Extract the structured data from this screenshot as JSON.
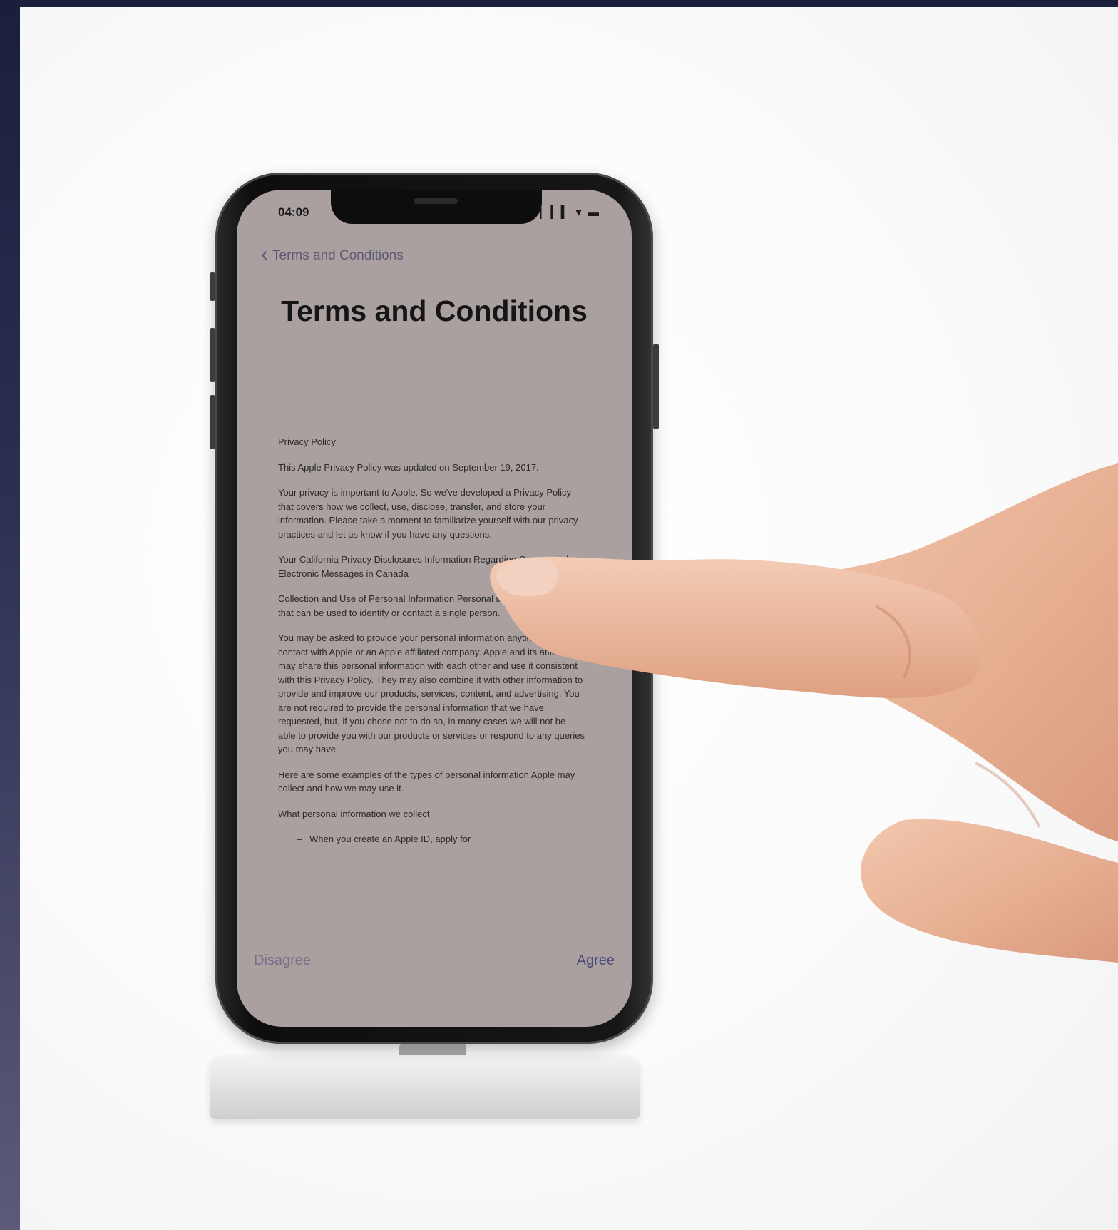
{
  "status_bar": {
    "time": "04:09",
    "icons": "▏▎▍ ▾ ▬"
  },
  "nav": {
    "back_label": "Terms and Conditions"
  },
  "title": "Terms and Conditions",
  "document": {
    "paragraphs": [
      "Privacy Policy",
      "This Apple Privacy Policy was updated on September 19, 2017.",
      "Your privacy is important to Apple. So we've developed a Privacy Policy that covers how we collect, use, disclose, transfer, and store your information. Please take a moment to familiarize yourself with our privacy practices and let us know if you have any questions.",
      "Your California Privacy Disclosures Information Regarding Commercial Electronic Messages in Canada",
      "Collection and Use of Personal Information Personal information is data that can be used to identify or contact a single person.",
      "You may be asked to provide your personal information anytime you are in contact with Apple or an Apple affiliated company. Apple and its affiliates may share this personal information with each other and use it consistent with this Privacy Policy. They may also combine it with other information to provide and improve our products, services, content, and advertising. You are not required to provide the personal information that we have requested, but, if you chose not to do so, in many cases we will not be able to provide you with our products or services or respond to any queries you may have.",
      "Here are some examples of the types of personal information Apple may collect and how we may use it.",
      "What personal information we collect"
    ],
    "bullet": "When you create an Apple ID, apply for"
  },
  "footer": {
    "disagree_label": "Disagree",
    "agree_label": "Agree"
  }
}
